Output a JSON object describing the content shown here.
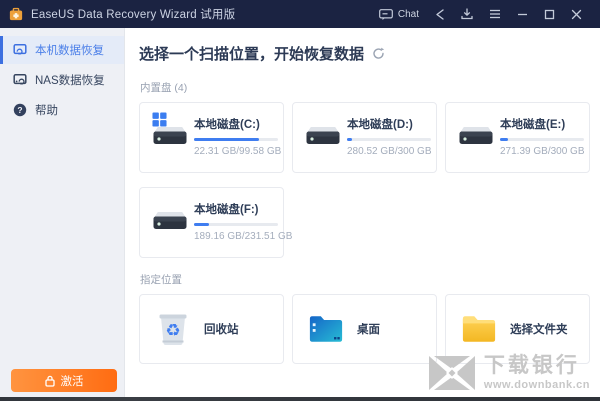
{
  "window": {
    "title": "EaseUS Data Recovery Wizard 试用版"
  },
  "titlebar": {
    "chat_label": "Chat",
    "icons": [
      "chat-icon",
      "share-icon",
      "download-icon",
      "menu-icon",
      "minimize-icon",
      "maximize-icon",
      "close-icon"
    ]
  },
  "sidebar": {
    "items": [
      {
        "label": "本机数据恢复",
        "icon": "pc-recovery-icon",
        "selected": true
      },
      {
        "label": "NAS数据恢复",
        "icon": "nas-recovery-icon",
        "selected": false
      },
      {
        "label": "帮助",
        "icon": "help-icon",
        "selected": false
      }
    ],
    "activate_label": "激活"
  },
  "main": {
    "header": "选择一个扫描位置，开始恢复数据",
    "internal_section_label": "内置盘 (4)",
    "locations_section_label": "指定位置",
    "drives": [
      {
        "name": "本地磁盘(C:)",
        "size": "22.31 GB/99.58 GB",
        "used_percent": 77.6,
        "system": true
      },
      {
        "name": "本地磁盘(D:)",
        "size": "280.52 GB/300 GB",
        "used_percent": 6.5,
        "system": false
      },
      {
        "name": "本地磁盘(E:)",
        "size": "271.39 GB/300 GB",
        "used_percent": 9.5,
        "system": false
      },
      {
        "name": "本地磁盘(F:)",
        "size": "189.16 GB/231.51 GB",
        "used_percent": 18.3,
        "system": false
      }
    ],
    "locations": [
      {
        "label": "回收站",
        "icon": "recycle-bin-icon"
      },
      {
        "label": "桌面",
        "icon": "desktop-folder-icon"
      },
      {
        "label": "选择文件夹",
        "icon": "choose-folder-icon"
      }
    ]
  },
  "watermark": {
    "name": "下载银行",
    "url": "www.downbank.cn"
  },
  "colors": {
    "titlebar_bg": "#1b2342",
    "sidebar_bg": "#eef0f5",
    "accent_blue": "#3f7df0",
    "activate_orange": "#ff6c12",
    "card_border": "#e8eaef"
  }
}
